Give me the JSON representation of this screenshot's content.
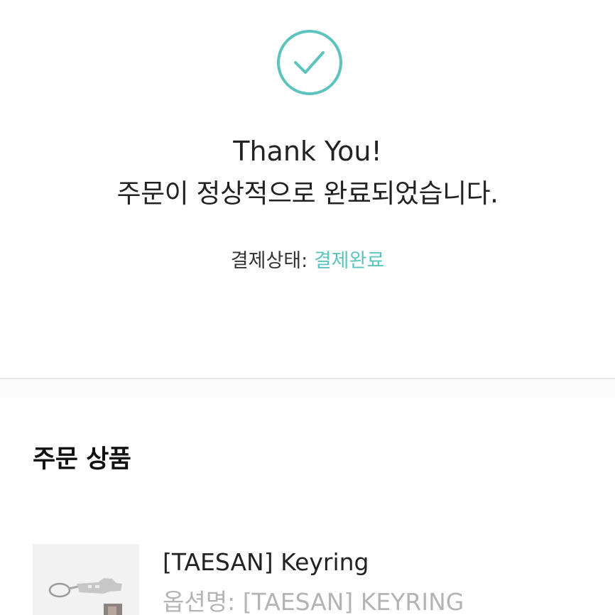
{
  "confirmation": {
    "title": "Thank You!",
    "message": "주문이 정상적으로 완료되었습니다.",
    "payment_status_label": "결제상태:",
    "payment_status_value": "결제완료"
  },
  "order_products": {
    "heading": "주문 상품",
    "items": [
      {
        "name": "[TAESAN] Keyring",
        "option_text": "옵션명: [TAESAN] KEYRING"
      }
    ]
  },
  "colors": {
    "accent": "#5cc4bd",
    "text": "#222222",
    "muted": "#b4b4b4",
    "divider": "#e8e8ec"
  },
  "icons": {
    "success": "check-circle-icon",
    "product_image": "keyring-product-image"
  }
}
